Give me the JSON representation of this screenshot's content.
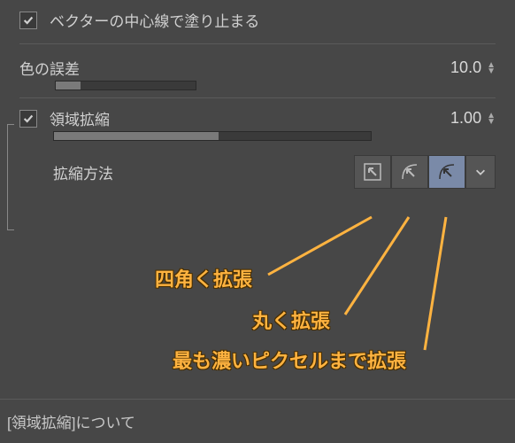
{
  "options": {
    "vector_stop": {
      "label": "ベクターの中心線で塗り止まる",
      "checked": true
    },
    "color_tolerance": {
      "label": "色の誤差",
      "value": "10.0",
      "fill_percent": 18
    },
    "area_scaling": {
      "label": "領域拡縮",
      "checked": true,
      "value": "1.00",
      "fill_percent": 52
    },
    "scaling_method": {
      "label": "拡縮方法",
      "selected_index": 2
    }
  },
  "annotations": {
    "a1": "四角く拡張",
    "a2": "丸く拡張",
    "a3": "最も濃いピクセルまで拡張"
  },
  "footer": {
    "label": "[領域拡縮]について"
  }
}
